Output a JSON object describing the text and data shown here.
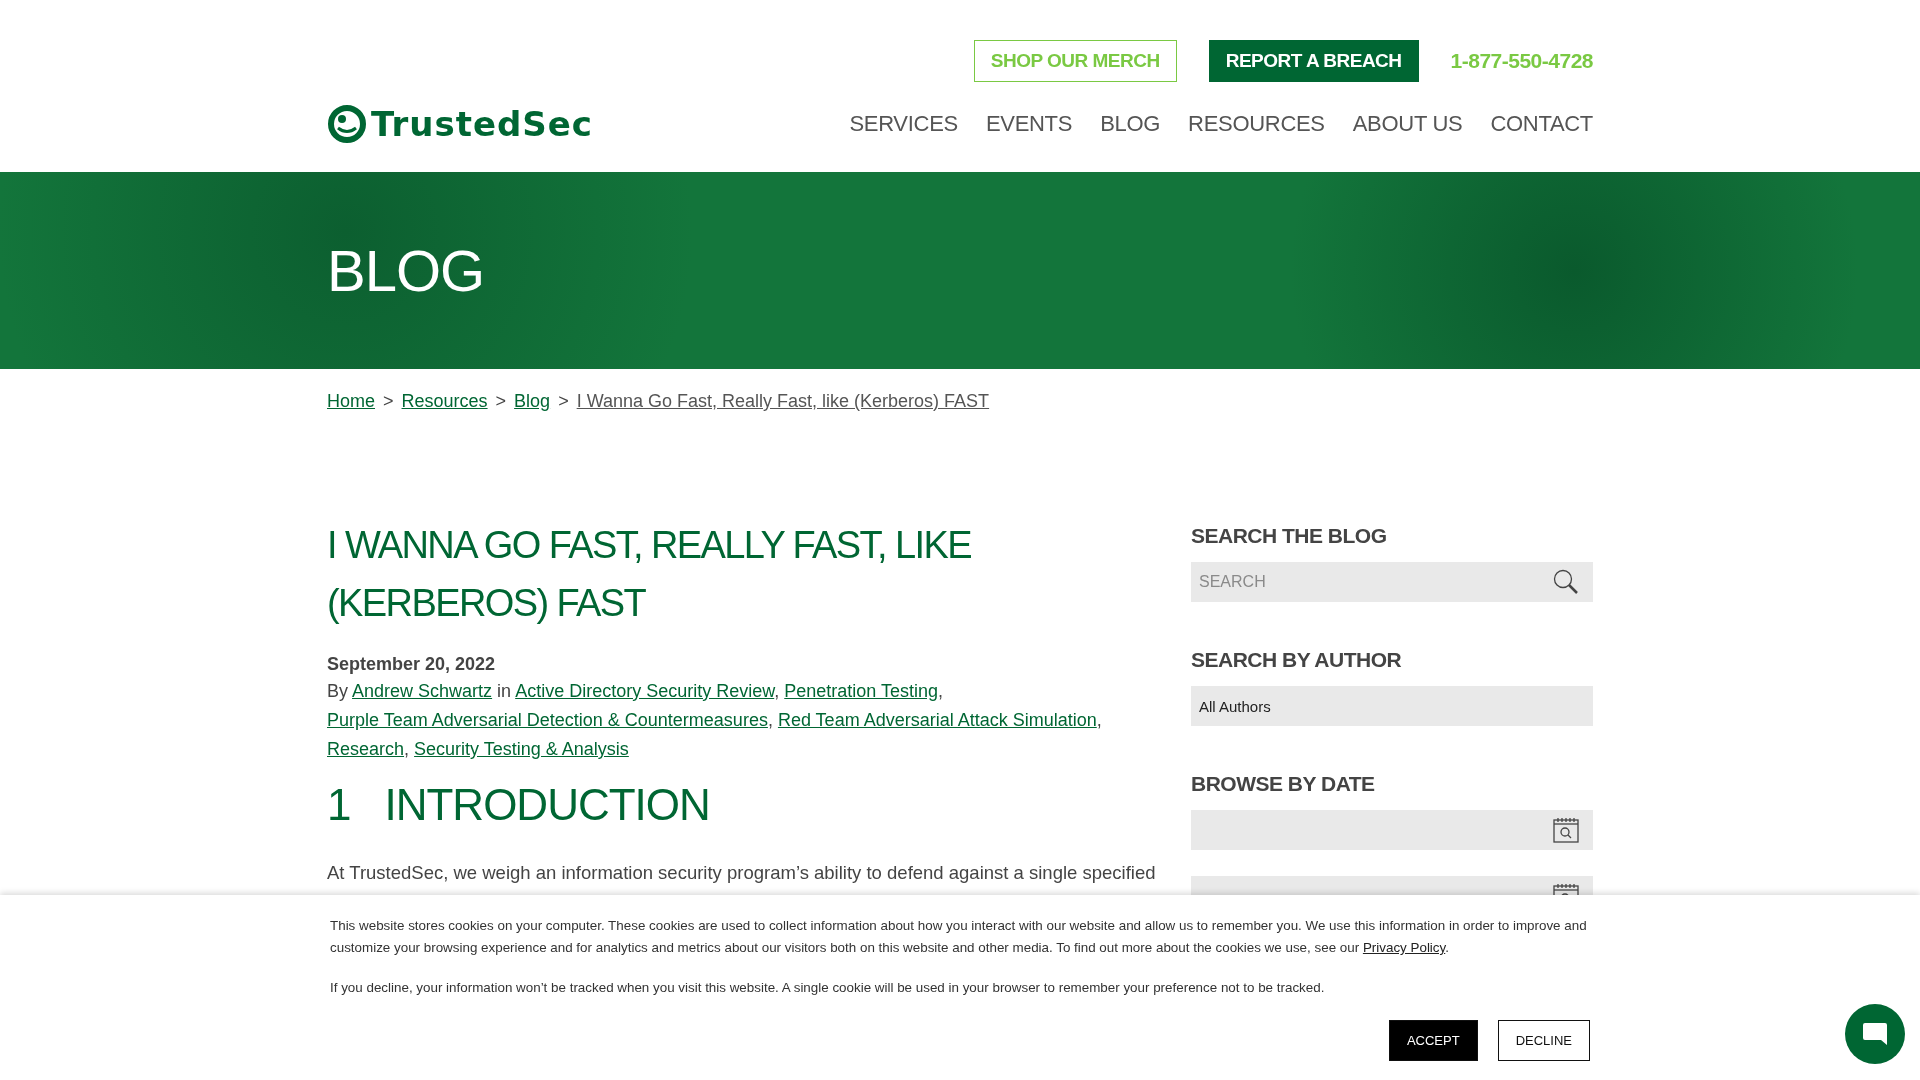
{
  "header": {
    "utility_buttons": [
      {
        "label": "SHOP OUR MERCH",
        "kind": "outline"
      },
      {
        "label": "REPORT A BREACH",
        "kind": "solid"
      }
    ],
    "phone": "1-877-550-4728",
    "logo": "TrustedSec",
    "nav": [
      "SERVICES",
      "EVENTS",
      "BLOG",
      "RESOURCES",
      "ABOUT US",
      "CONTACT"
    ]
  },
  "hero": {
    "title": "BLOG"
  },
  "breadcrumb": [
    {
      "label": "Home",
      "current": false
    },
    {
      "label": "Resources",
      "current": false
    },
    {
      "label": "Blog",
      "current": false
    },
    {
      "label": "I Wanna Go Fast, Really Fast, like (Kerberos) FAST",
      "current": true
    }
  ],
  "breadcrumb_separator": ">",
  "article": {
    "title": "I WANNA GO FAST, REALLY FAST, LIKE (KERBEROS) FAST",
    "date": "September 20, 2022",
    "byline_prefix": "By",
    "author": "Andrew Schwartz",
    "byline_connector": "in",
    "category_separator": ",",
    "categories": [
      "Active Directory Security Review",
      "Penetration Testing",
      "Purple Team Adversarial Detection & Countermeasures",
      "Red Team Adversarial Attack Simulation",
      "Research",
      "Security Testing & Analysis"
    ],
    "section_number": "1",
    "section_title": "INTRODUCTION",
    "paragraph": "At TrustedSec, we weigh an information security program’s ability to defend against a single specified"
  },
  "sidebar": {
    "search_heading": "SEARCH THE BLOG",
    "search_placeholder": "SEARCH",
    "author_heading": "SEARCH BY AUTHOR",
    "author_value": "All Authors",
    "date_heading": "BROWSE BY DATE"
  },
  "cookie_banner": {
    "text_before": "This website stores cookies on your computer. These cookies are used to collect information about how you interact with our website and allow us to remember you. We use this information in order to improve and customize your browsing experience and for analytics and metrics about our visitors both on this website and other media. To find out more about the cookies we use, see our ",
    "link": "Privacy Policy",
    "text_after": ".",
    "text_2": "If you decline, your information won’t be tracked when you visit this website. A single cookie will be used in your browser to remember your preference not to be tracked.",
    "buttons": [
      {
        "label": "ACCEPT",
        "kind": "solid"
      },
      {
        "label": "DECLINE",
        "kind": "outline"
      }
    ]
  }
}
